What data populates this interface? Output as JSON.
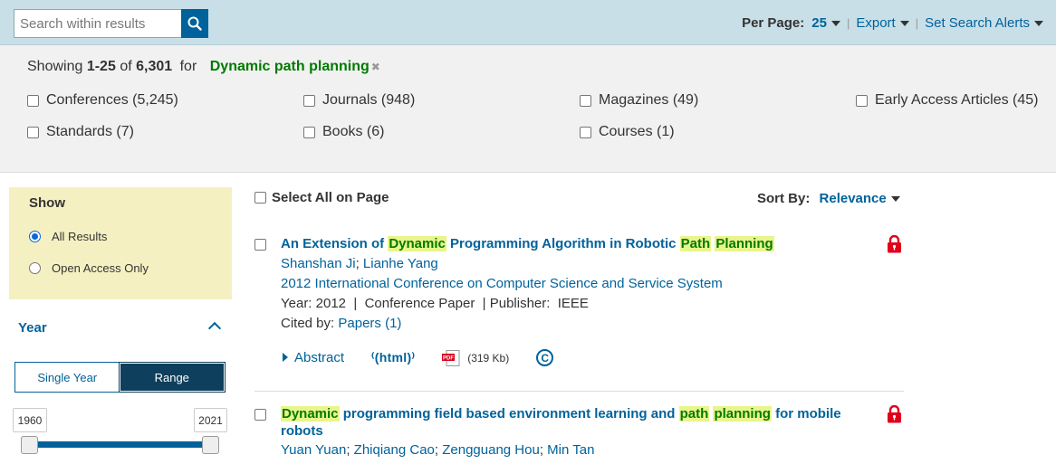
{
  "search": {
    "placeholder": "Search within results"
  },
  "topbar": {
    "per_page_label": "Per Page:",
    "per_page_value": "25",
    "export_label": "Export",
    "alerts_label": "Set Search Alerts"
  },
  "summary": {
    "showing": "Showing",
    "range": "1-25",
    "of": "of",
    "total": "6,301",
    "for": "for",
    "query": "Dynamic path planning"
  },
  "content_types": [
    {
      "label": "Conferences (5,245)"
    },
    {
      "label": "Journals (948)"
    },
    {
      "label": "Magazines (49)"
    },
    {
      "label": "Early Access Articles (45)"
    },
    {
      "label": "Standards (7)"
    },
    {
      "label": "Books (6)"
    },
    {
      "label": "Courses (1)"
    }
  ],
  "show_panel": {
    "title": "Show",
    "options": [
      {
        "label": "All Results",
        "selected": true
      },
      {
        "label": "Open Access Only",
        "selected": false
      }
    ]
  },
  "year_panel": {
    "title": "Year",
    "single_label": "Single Year",
    "range_label": "Range",
    "from": "1960",
    "to": "2021"
  },
  "results_header": {
    "select_all": "Select All on Page",
    "sort_label": "Sort By:",
    "sort_value": "Relevance"
  },
  "results": [
    {
      "title_parts": [
        "An Extension of ",
        "Dynamic",
        " Programming Algorithm in Robotic ",
        "Path",
        " ",
        "Planning"
      ],
      "authors": [
        "Shanshan Ji",
        "Lianhe Yang"
      ],
      "venue": "2012 International Conference on Computer Science and Service System",
      "meta": "Year: 2012  |  Conference Paper  | Publisher:  IEEE",
      "cited_label": "Cited by:",
      "cited_link": "Papers (1)",
      "abstract_label": "Abstract",
      "html_label": "html",
      "pdf_label": "PDF",
      "pdf_size": "(319 Kb)",
      "copyright_icon": "copyright-icon"
    },
    {
      "title_line1_parts": [
        "Dynamic",
        " programming field based environment learning and ",
        "path",
        " ",
        "planning",
        " for mobile"
      ],
      "title_line2": "robots",
      "authors": [
        "Yuan Yuan",
        "Zhiqiang Cao",
        "Zengguang Hou",
        "Min Tan"
      ]
    }
  ],
  "colors": {
    "accent": "#00629b",
    "highlight_bg": "#e9f58a",
    "query_green": "#007a00",
    "lock_red": "#e1001b",
    "show_panel_bg": "#f5f0c1",
    "topbar_bg": "#c9dfe8"
  }
}
